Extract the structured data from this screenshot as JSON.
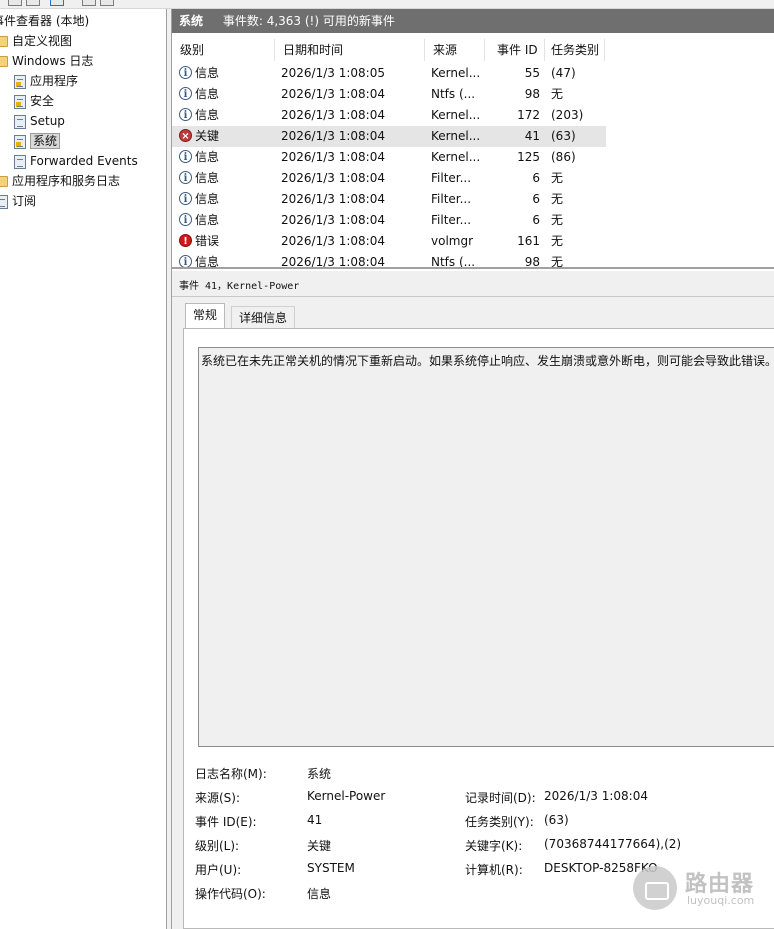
{
  "tree": {
    "items": [
      {
        "label": "事件查看器 (本地)"
      },
      {
        "label": "自定义视图"
      },
      {
        "label": "Windows 日志"
      },
      {
        "label": "应用程序"
      },
      {
        "label": "安全"
      },
      {
        "label": "Setup"
      },
      {
        "label": "系统"
      },
      {
        "label": "Forwarded Events"
      },
      {
        "label": "应用程序和服务日志"
      },
      {
        "label": "订阅"
      }
    ]
  },
  "header": {
    "title": "系统",
    "summary": "事件数: 4,363 (!) 可用的新事件"
  },
  "list": {
    "columns": [
      "级别",
      "日期和时间",
      "来源",
      "事件 ID",
      "任务类别"
    ],
    "rows": [
      {
        "level": "信息",
        "datetime": "2026/1/3 1:08:05",
        "source": "Kernel...",
        "id": "55",
        "task": "(47)"
      },
      {
        "level": "信息",
        "datetime": "2026/1/3 1:08:04",
        "source": "Ntfs (...",
        "id": "98",
        "task": "无"
      },
      {
        "level": "信息",
        "datetime": "2026/1/3 1:08:04",
        "source": "Kernel...",
        "id": "172",
        "task": "(203)"
      },
      {
        "level": "关键",
        "datetime": "2026/1/3 1:08:04",
        "source": "Kernel...",
        "id": "41",
        "task": "(63)"
      },
      {
        "level": "信息",
        "datetime": "2026/1/3 1:08:04",
        "source": "Kernel...",
        "id": "125",
        "task": "(86)"
      },
      {
        "level": "信息",
        "datetime": "2026/1/3 1:08:04",
        "source": "Filter...",
        "id": "6",
        "task": "无"
      },
      {
        "level": "信息",
        "datetime": "2026/1/3 1:08:04",
        "source": "Filter...",
        "id": "6",
        "task": "无"
      },
      {
        "level": "信息",
        "datetime": "2026/1/3 1:08:04",
        "source": "Filter...",
        "id": "6",
        "task": "无"
      },
      {
        "level": "错误",
        "datetime": "2026/1/3 1:08:04",
        "source": "volmgr",
        "id": "161",
        "task": "无"
      },
      {
        "level": "信息",
        "datetime": "2026/1/3 1:08:04",
        "source": "Ntfs (...",
        "id": "98",
        "task": "无"
      }
    ]
  },
  "detail": {
    "title": "事件 41，Kernel-Power",
    "tabs": {
      "general": "常规",
      "details": "详细信息"
    },
    "description": "系统已在未先正常关机的情况下重新启动。如果系统停止响应、发生崩溃或意外断电，则可能会导致此错误。",
    "fields": {
      "log_name_label": "日志名称(M):",
      "log_name": "系统",
      "source_label": "来源(S):",
      "source": "Kernel-Power",
      "logged_label": "记录时间(D):",
      "logged": "2026/1/3 1:08:04",
      "event_id_label": "事件 ID(E):",
      "event_id": "41",
      "task_label": "任务类别(Y):",
      "task": "(63)",
      "level_label": "级别(L):",
      "level": "关键",
      "keywords_label": "关键字(K):",
      "keywords": "(70368744177664),(2)",
      "user_label": "用户(U):",
      "user": "SYSTEM",
      "computer_label": "计算机(R):",
      "computer": "DESKTOP-8258FKO",
      "opcode_label": "操作代码(O):",
      "opcode": "信息"
    }
  },
  "watermark": {
    "name": "路由器",
    "url": "luyouqi.com"
  }
}
